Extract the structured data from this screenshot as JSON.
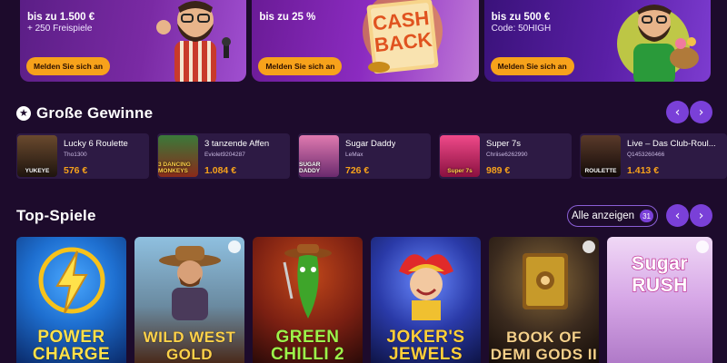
{
  "promos": [
    {
      "title": "bis zu 1.500 €",
      "subtitle": "+ 250 Freispiele",
      "button": "Melden Sie sich an"
    },
    {
      "title": "bis zu 25 %",
      "subtitle": "",
      "button": "Melden Sie sich an",
      "art_text_1": "CASH",
      "art_text_2": "BACK"
    },
    {
      "title": "bis zu 500 €",
      "subtitle": "Code: 50HIGH",
      "button": "Melden Sie sich an"
    }
  ],
  "wins_section": {
    "title": "Große Gewinne",
    "icon": "star-icon",
    "prev_icon": "‹",
    "next_icon": "›"
  },
  "wins": [
    {
      "game": "Lucky 6 Roulette",
      "user": "Tho1300",
      "amount": "576 €",
      "thumb_label": "YUKEYE",
      "color": "#3b2a1e"
    },
    {
      "game": "3 tanzende Affen",
      "user": "Eviolet9204287",
      "amount": "1.084 €",
      "thumb_label": "3 DANCING MONKEYS",
      "color": "#7a2b1a"
    },
    {
      "game": "Sugar Daddy",
      "user": "LeMax",
      "amount": "726 €",
      "thumb_label": "SUGAR DADDY",
      "color": "#9b3a6e"
    },
    {
      "game": "Super 7s",
      "user": "Chriise6262990",
      "amount": "989 €",
      "thumb_label": "Super 7s",
      "color": "#c2185b"
    },
    {
      "game": "Live – Das Club-Roul...",
      "user": "Q1453260466",
      "amount": "1.413 €",
      "thumb_label": "ROULETTE",
      "color": "#2a1f1a"
    }
  ],
  "top_section": {
    "title": "Top-Spiele",
    "view_all": "Alle anzeigen",
    "count": "31",
    "prev_icon": "‹",
    "next_icon": "›"
  },
  "games": [
    {
      "line1": "POWER",
      "line2": "CHARGE",
      "color": "#1e6fd0",
      "accent": "#f7c21b",
      "text_color": "#ffe14a"
    },
    {
      "line1": "WILD WEST",
      "line2": "GOLD",
      "color": "#6fa6c8",
      "accent": "#c98b3a",
      "text_color": "#ffd24a"
    },
    {
      "line1": "GREEN",
      "line2": "CHILLI 2",
      "color": "#7a1f12",
      "accent": "#3ea52a",
      "text_color": "#9df24a"
    },
    {
      "line1": "JOKER'S",
      "line2": "JEWELS",
      "color": "#2a3aa8",
      "accent": "#f0c030",
      "text_color": "#ffcf3a"
    },
    {
      "line1": "BOOK OF",
      "line2": "DEMI GODS II",
      "color": "#3a2a1e",
      "accent": "#c79a2a",
      "text_color": "#f5d08a"
    },
    {
      "line1": "Sugar",
      "line2": "RUSH",
      "color": "#d6a6e6",
      "accent": "#f07ac0",
      "text_color": "#ffffff"
    }
  ],
  "colors": {
    "accent": "#f7a21b",
    "brand_purple": "#7a40d8",
    "background": "#1d0b2c"
  }
}
